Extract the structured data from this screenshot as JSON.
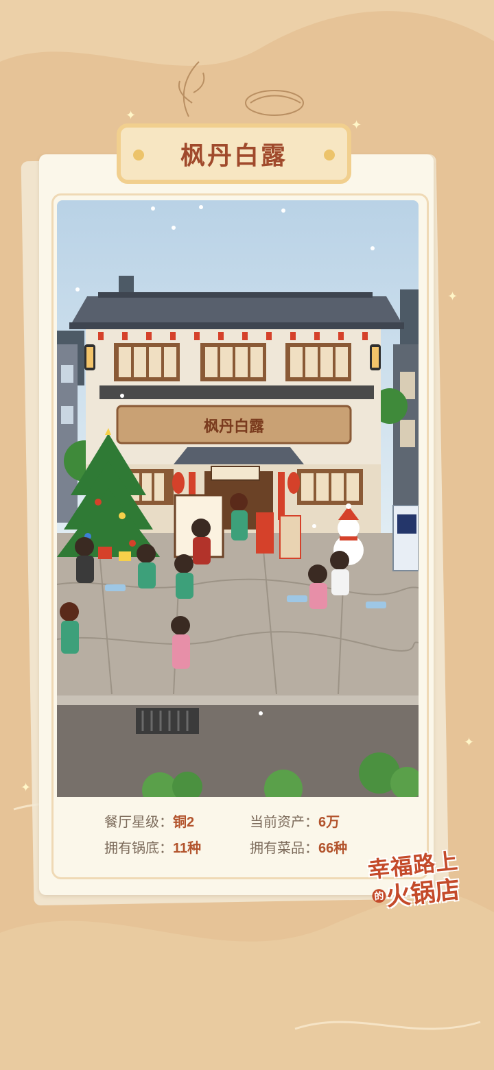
{
  "restaurant": {
    "name": "枫丹白露",
    "sign_text": "枫丹白露"
  },
  "stats": {
    "star_label": "餐厅星级：",
    "star_value": "铜2",
    "assets_label": "当前资产：",
    "assets_value": "6万",
    "pots_label": "拥有锅底：",
    "pots_value": "11种",
    "dishes_label": "拥有菜品：",
    "dishes_value": "66种"
  },
  "logo": {
    "line1": "幸福路上",
    "de": "的",
    "line2": "火锅店"
  },
  "colors": {
    "background": "#e6c397",
    "title": "#a04a2c",
    "value": "#b2532c",
    "label": "#7b6a5a"
  }
}
